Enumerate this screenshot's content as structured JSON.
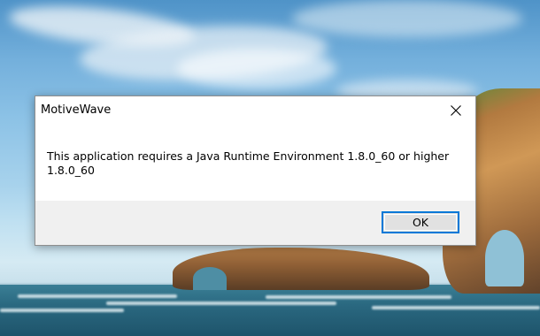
{
  "dialog": {
    "title": "MotiveWave",
    "message": "This application requires a Java Runtime Environment 1.8.0_60 or higher\n1.8.0_60",
    "ok_label": "OK",
    "close_icon": "close-icon"
  },
  "colors": {
    "dialog_background": "#ffffff",
    "button_bar_background": "#f0f0f0",
    "ok_button_border": "#0078d7",
    "ok_button_background": "#e1e1e1"
  }
}
